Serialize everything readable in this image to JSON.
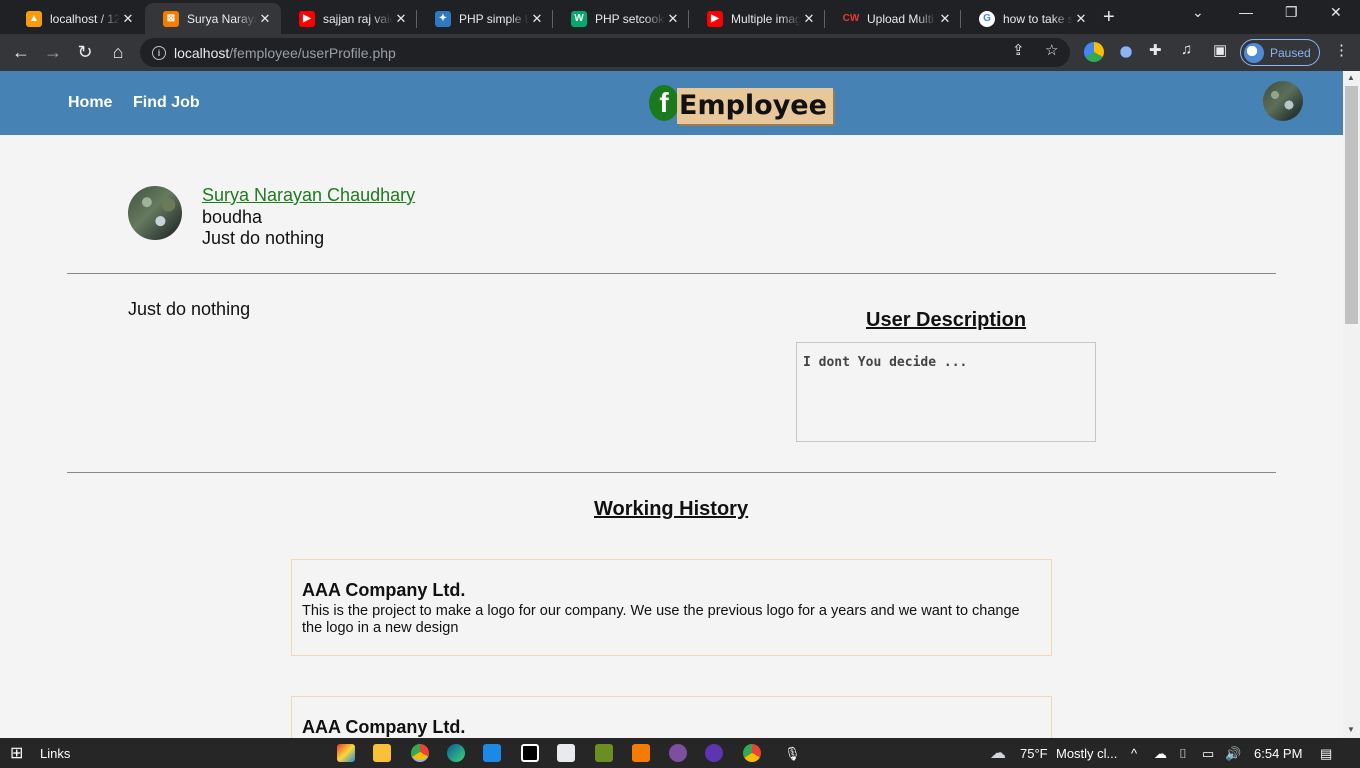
{
  "browser": {
    "tabs": [
      {
        "title": "localhost / 12",
        "color": "#f89c0e"
      },
      {
        "title": "Surya Narayan",
        "color": "#f57c00"
      },
      {
        "title": "sajjan raj vaid",
        "color": "#ff0000"
      },
      {
        "title": "PHP simple L",
        "color": "#2d7ac0"
      },
      {
        "title": "PHP setcooki",
        "color": "#04aa6d"
      },
      {
        "title": "Multiple imag",
        "color": "#ff0000"
      },
      {
        "title": "Upload Multi",
        "color": "#c62828"
      },
      {
        "title": "how to take s",
        "color": "#4285f4"
      }
    ],
    "active_tab": 1,
    "url_host": "localhost",
    "url_path": "/femployee/userProfile.php",
    "profile_label": "Paused"
  },
  "site": {
    "nav": {
      "home": "Home",
      "find_job": "Find Job"
    },
    "logo": {
      "f": "f",
      "word": "Employee"
    }
  },
  "profile": {
    "name": "Surya Narayan Chaudhary",
    "line1": "boudha",
    "line2": "Just do nothing",
    "about": "Just do nothing",
    "description_title": "User Description",
    "description_text": "I dont You decide ..."
  },
  "history": {
    "title": "Working History",
    "jobs": [
      {
        "company": "AAA Company Ltd.",
        "description": "This is the project to make a logo for our company. We use the previous logo for a years and we want to change the logo in a new design"
      },
      {
        "company": "AAA Company Ltd.",
        "description": ""
      }
    ]
  },
  "taskbar": {
    "links": "Links",
    "weather_temp": "75°F",
    "weather_text": "Mostly cl...",
    "time": "6:54 PM"
  }
}
